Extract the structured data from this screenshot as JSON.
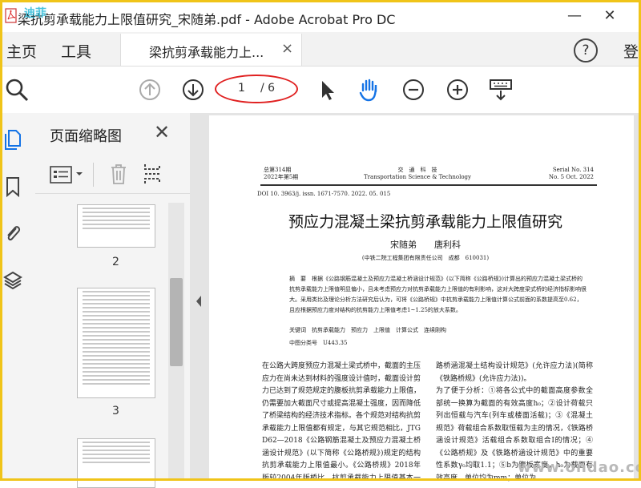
{
  "window": {
    "title": "梁抗剪承载能力上限值研究_宋随弟.pdf - Adobe Acrobat Pro DC",
    "minimize": "—",
    "close": "✕"
  },
  "menu": {
    "home": "主页",
    "tools": "工具",
    "doc_tab": "梁抗剪承载能力上...",
    "tab_close": "×",
    "help": "?",
    "login": "登"
  },
  "toolbar": {
    "current_page": "1",
    "total_pages": "/ 6",
    "icons": [
      "search-icon",
      "page-up-icon",
      "page-down-icon",
      "select-cursor-icon",
      "hand-tool-icon",
      "zoom-out-icon",
      "zoom-in-icon",
      "keyboard-icon"
    ]
  },
  "left_rail": {
    "icons": [
      "pages-icon",
      "bookmark-icon",
      "attachment-icon",
      "layers-icon"
    ]
  },
  "thumbnail_panel": {
    "title": "页面缩略图",
    "close": "✕",
    "pages": [
      {
        "label": "2"
      },
      {
        "label": "3"
      }
    ]
  },
  "document": {
    "header_left_1": "总第314期",
    "header_left_2": "2022年第5期",
    "header_center_1": "交　通　科　技",
    "header_center_2": "Transportation Science & Technology",
    "header_right_1": "Serial No. 314",
    "header_right_2": "No. 5 Oct. 2022",
    "doi": "DOI 10. 3963/j. issn. 1671-7570. 2022. 05. 015",
    "title": "预应力混凝土梁抗剪承载能力上限值研究",
    "authors": "宋随弟　　唐利科",
    "affiliation": "(中铁二院工程集团有限责任公司　成都　610031)",
    "abstract": "摘　要　根据《公路钢筋混凝土及预应力混凝土桥涵设计规范》(以下简称《公路桥规》)计算出的预应力混凝土梁式桥的抗剪承载能力上限值明显偏小，且未考虑预应力对抗剪承载能力上限值的有利影响，这对大跨度梁式桥的经济指标影响很大。采用类比及理论分析方法研究后认为，可将《公路桥规》中抗剪承载能力上限值计算公式前面的系数提高至0.62，且应根据预应力度对结构的抗剪能力上限值考虑1~1.25的放大系数。",
    "keywords": "关键词　抗剪承载能力　预应力　上限值　计算公式　连续刚构",
    "clc": "中图分类号　U443.35",
    "col_left": "在公路大跨度预应力混凝土梁式桥中，截面的主压应力在尚未达到材料的强度设计值时，截面设计剪力已达到了规范规定的腹板抗剪承载能力上限值，仍需要加大截面尺寸或提高混凝土强度，因而降低了桥梁结构的经济技术指标。各个规范对结构抗剪承载能力上限值都有规定，与其它规范相比，JTG D62—2018《公路钢筋混凝土及预应力混凝土桥涵设计规范》(以下简称《公路桥规》)规定的结构抗剪承载能力上限值最小。《公路桥规》2018年版较2004年版桥比，抗剪承载能力上限值基本一致，在公路连续刚构等桥梁设计中",
    "col_right": "路桥涵混凝土结构设计规范》(允许应力法)(简称《铁路桥规》(允许应力法))。\n为了便于分析：①将各公式中的截面高度参数全部统一换算为截面的有效高度h₀；②设计荷载只列出恒载与汽车(列车或楼面活载)；③《混凝土规范》荷载组合系数取恒载为主的情况，《铁路桥涵设计规范》活载组合系数取组合Ⅰ的情况；④《公路桥规》及《铁路桥涵设计规范》中的重要性系数γ₀均取1.1；⑤b为腹板宽度，h₀为截面有效高度，单位均为mm；单位为"
  },
  "watermarks": {
    "top_left": "迪菲",
    "bottom_right": "www.ondao.com"
  },
  "colors": {
    "accent_red": "#e02020",
    "icon_blue": "#1473e6",
    "frame_yellow": "#f0c419"
  }
}
